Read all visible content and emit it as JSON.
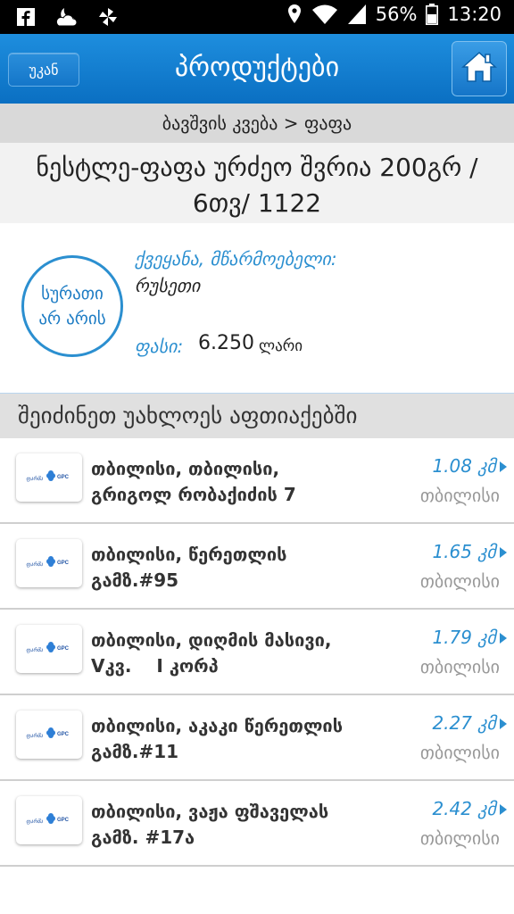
{
  "status_bar": {
    "battery": "56%",
    "time": "13:20",
    "icons": [
      "facebook-icon",
      "cloud-moon-icon",
      "pinwheel-icon",
      "location-icon",
      "wifi-icon",
      "signal-icon",
      "battery-icon"
    ]
  },
  "header": {
    "back_label": "უკან",
    "title": "პროდუქტები",
    "home_icon": "home-icon",
    "color": "#0f78c9"
  },
  "breadcrumb": "ბავშვის კვება > ფაფა",
  "product": {
    "title_line1": "ნესტლე-ფაფა ურძეო შვრია 200გრ /",
    "title_line2": "6თვ/ 1122",
    "no_image_line1": "სურათი",
    "no_image_line2": "არ არის",
    "maker_label": "ქვეყანა, მწარმოებელი:",
    "maker_value": "რუსეთი",
    "price_label": "ფასი:",
    "price_value": "6.250",
    "price_currency": "ლარი"
  },
  "stations_header": "შეიძინეთ უახლოეს აფთიაქებში",
  "stations": [
    {
      "line1": "თბილისი, თბილისი,",
      "line2": "გრიგოლ რობაქიძის 7",
      "distance": "1.08 კმ",
      "city": "თბილისი"
    },
    {
      "line1": "თბილისი, წერეთლის",
      "line2": "გამზ.#95",
      "distance": "1.65 კმ",
      "city": "თბილისი"
    },
    {
      "line1": "თბილისი, დიღმის მასივი,",
      "line2": "Vკვ.    I კორპ",
      "distance": "1.79 კმ",
      "city": "თბილისი"
    },
    {
      "line1": "თბილისი, აკაკი წერეთლის",
      "line2": "გამზ.#11",
      "distance": "2.27 კმ",
      "city": "თბილისი"
    },
    {
      "line1": "თბილისი, ვაჟა ფშაველას",
      "line2": "გამზ. #17ა",
      "distance": "2.42 კმ",
      "city": "თბილისი"
    }
  ],
  "logo_text": "GPC",
  "colors": {
    "accent": "#2b8fd0",
    "appbar": "#0f78c9"
  }
}
